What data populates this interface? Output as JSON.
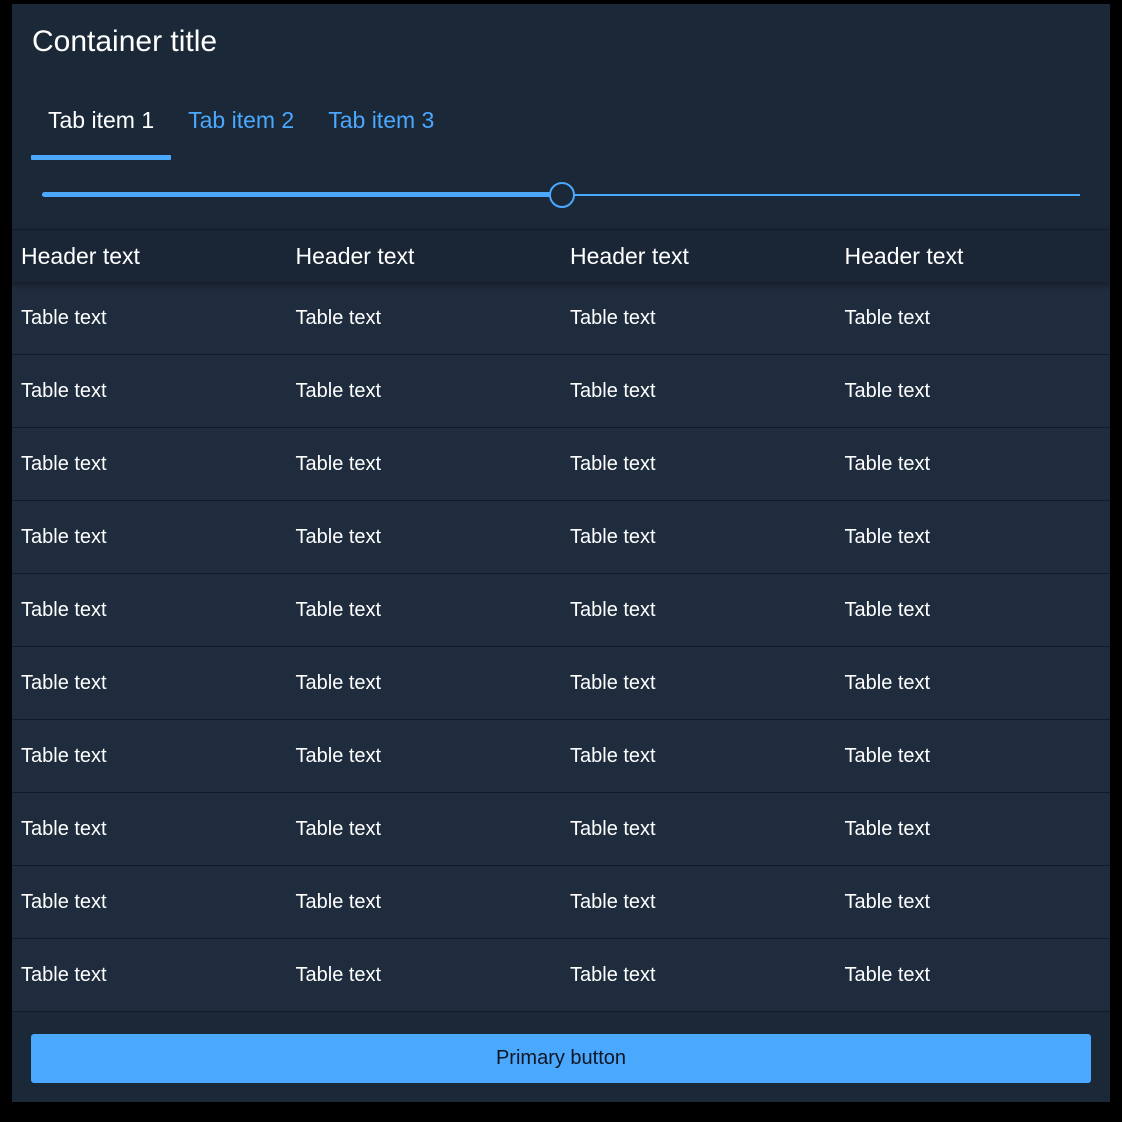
{
  "container": {
    "title": "Container title"
  },
  "tabs": [
    {
      "label": "Tab item 1",
      "active": true
    },
    {
      "label": "Tab item 2",
      "active": false
    },
    {
      "label": "Tab item 3",
      "active": false
    }
  ],
  "slider": {
    "value_fraction": 0.5
  },
  "table": {
    "headers": [
      "Header text",
      "Header text",
      "Header text",
      "Header text"
    ],
    "rows": [
      [
        "Table text",
        "Table text",
        "Table text",
        "Table text"
      ],
      [
        "Table text",
        "Table text",
        "Table text",
        "Table text"
      ],
      [
        "Table text",
        "Table text",
        "Table text",
        "Table text"
      ],
      [
        "Table text",
        "Table text",
        "Table text",
        "Table text"
      ],
      [
        "Table text",
        "Table text",
        "Table text",
        "Table text"
      ],
      [
        "Table text",
        "Table text",
        "Table text",
        "Table text"
      ],
      [
        "Table text",
        "Table text",
        "Table text",
        "Table text"
      ],
      [
        "Table text",
        "Table text",
        "Table text",
        "Table text"
      ],
      [
        "Table text",
        "Table text",
        "Table text",
        "Table text"
      ],
      [
        "Table text",
        "Table text",
        "Table text",
        "Table text"
      ]
    ]
  },
  "footer": {
    "primary_button_label": "Primary button"
  },
  "colors": {
    "accent": "#4aa8ff",
    "background": "#1b2838",
    "row_background": "#1e2c3d",
    "text": "#ffffff"
  }
}
